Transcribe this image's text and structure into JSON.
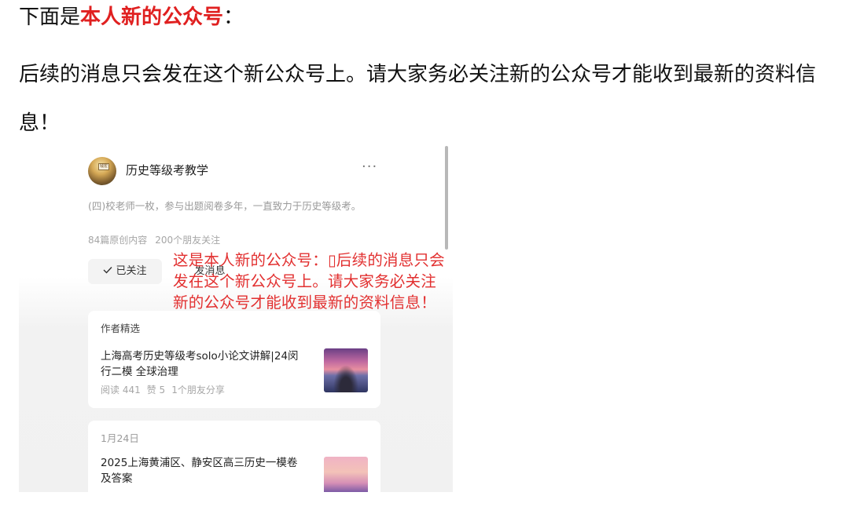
{
  "article": {
    "intro_prefix": "下面是",
    "intro_highlight": "本人新的公众号",
    "intro_suffix": "：",
    "paragraph": "后续的消息只会发在这个新公众号上。请大家务必关注新的公众号才能收到最新的资料信息！"
  },
  "profile": {
    "avatar_tag": "钱宏",
    "account_name": "历史等级考教学",
    "more_label": "···",
    "description": "(四)校老师一枚，参与出题阅卷多年，一直致力于历史等级考。",
    "stats": [
      "84篇原创内容",
      "200个朋友关注"
    ],
    "follow_label": "已关注",
    "follow_icon": "check-icon",
    "message_label": "发消息"
  },
  "overlay_text": "这是本人新的公众号：▯后续的消息只会发在这个新公众号上。请大家务必关注新的公众号才能收到最新的资料信息！",
  "cards": [
    {
      "header": "作者精选",
      "title": "上海高考历史等级考solo小论文讲解|24闵行二模 全球治理",
      "meta": [
        "阅读 441",
        "赞 5",
        "1个朋友分享"
      ]
    },
    {
      "header": "1月24日",
      "title": "2025上海黄浦区、静安区高三历史一模卷及答案"
    }
  ],
  "colors": {
    "highlight": "#e02020",
    "overlay": "#e23030"
  }
}
